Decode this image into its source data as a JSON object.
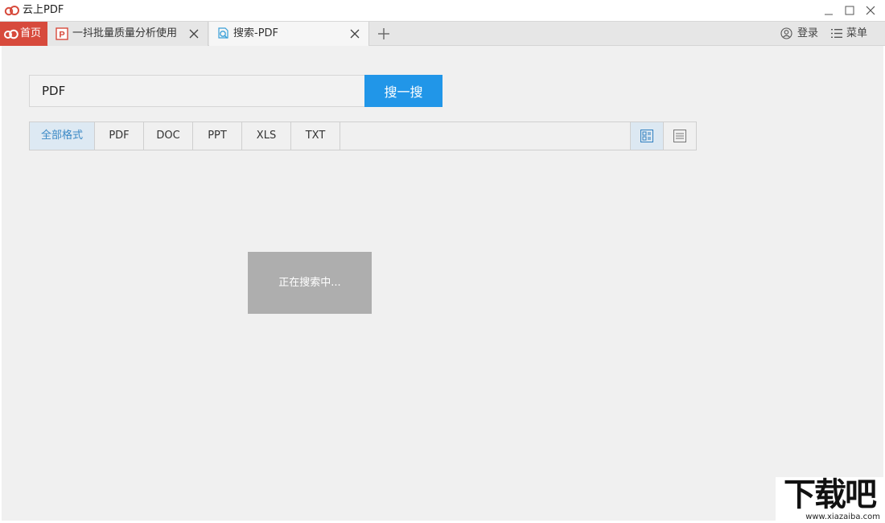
{
  "window": {
    "title": "云上PDF",
    "icons": {
      "logo": "cloud-logo-icon",
      "minimize": "minimize-icon",
      "maximize": "maximize-icon",
      "close": "close-icon"
    }
  },
  "tabs": {
    "home": {
      "label": "首页",
      "icon": "cloud-logo-icon"
    },
    "items": [
      {
        "label": "一抖批量质量分析使用",
        "icon": "pdf-file-icon",
        "active": false
      },
      {
        "label": "搜索-PDF",
        "icon": "search-tab-icon",
        "active": true
      }
    ],
    "new_tab_icon": "plus-icon"
  },
  "account": {
    "login_label": "登录",
    "menu_label": "菜单"
  },
  "search": {
    "query": "PDF",
    "button_label": "搜一搜"
  },
  "filters": {
    "items": [
      {
        "label": "全部格式",
        "active": true
      },
      {
        "label": "PDF",
        "active": false
      },
      {
        "label": "DOC",
        "active": false
      },
      {
        "label": "PPT",
        "active": false
      },
      {
        "label": "XLS",
        "active": false
      },
      {
        "label": "TXT",
        "active": false
      }
    ],
    "views": [
      {
        "name": "grid-view-icon",
        "active": true
      },
      {
        "name": "list-view-icon",
        "active": false
      }
    ]
  },
  "status": {
    "loading_text": "正在搜索中..."
  },
  "watermark": {
    "main": "下载吧",
    "sub": "www.xiazaiba.com"
  },
  "colors": {
    "accent": "#2196e8",
    "home_tab": "#d74a3c",
    "active_filter_text": "#3b89c5"
  }
}
